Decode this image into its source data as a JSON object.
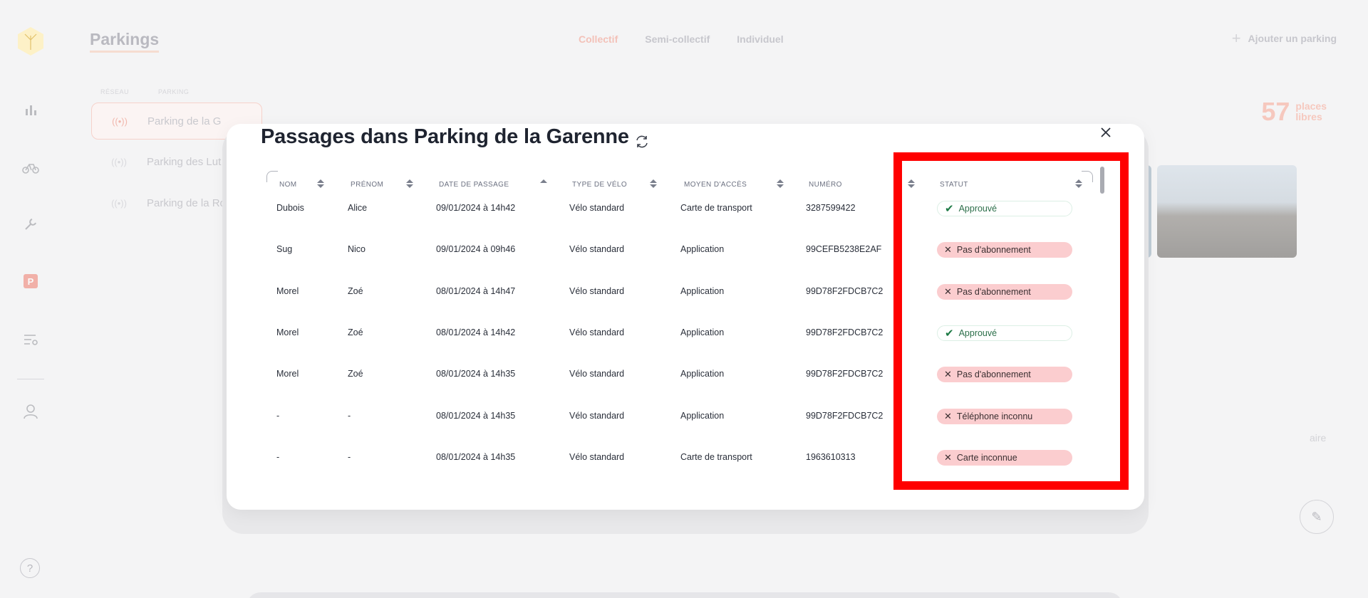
{
  "app": {
    "page_title": "Parkings",
    "tabs": [
      {
        "label": "Collectif",
        "active": true
      },
      {
        "label": "Semi-collectif",
        "active": false
      },
      {
        "label": "Individuel",
        "active": false
      }
    ],
    "add_button": "Ajouter un parking",
    "bg_table_headers": [
      "RÉSEAU",
      "PARKING"
    ],
    "bg_parkings": [
      {
        "label": "Parking de la G",
        "selected": true
      },
      {
        "label": "Parking des Lut",
        "selected": false
      },
      {
        "label": "Parking de la Ro",
        "selected": false
      }
    ],
    "places_count": "57",
    "places_label_1": "places",
    "places_label_2": "libres",
    "faded_text": "aire"
  },
  "modal": {
    "title": "Passages dans Parking de la Garenne",
    "columns": [
      {
        "key": "nom",
        "label": "NOM"
      },
      {
        "key": "prenom",
        "label": "PRÉNOM"
      },
      {
        "key": "date",
        "label": "DATE DE PASSAGE"
      },
      {
        "key": "type",
        "label": "TYPE DE VÉLO"
      },
      {
        "key": "acces",
        "label": "MOYEN D'ACCÈS"
      },
      {
        "key": "numero",
        "label": "NUMÉRO"
      },
      {
        "key": "statut",
        "label": "STATUT"
      }
    ],
    "rows": [
      {
        "nom": "Dubois",
        "prenom": "Alice",
        "date": "09/01/2024 à 14h42",
        "type": "Vélo standard",
        "acces": "Carte de transport",
        "numero": "3287599422",
        "statut": "Approuvé",
        "status_kind": "ok"
      },
      {
        "nom": "Sug",
        "prenom": "Nico",
        "date": "09/01/2024 à 09h46",
        "type": "Vélo standard",
        "acces": "Application",
        "numero": "99CEFB5238E2AF",
        "statut": "Pas d'abonnement",
        "status_kind": "err"
      },
      {
        "nom": "Morel",
        "prenom": "Zoé",
        "date": "08/01/2024 à 14h47",
        "type": "Vélo standard",
        "acces": "Application",
        "numero": "99D78F2FDCB7C2",
        "statut": "Pas d'abonnement",
        "status_kind": "err"
      },
      {
        "nom": "Morel",
        "prenom": "Zoé",
        "date": "08/01/2024 à 14h42",
        "type": "Vélo standard",
        "acces": "Application",
        "numero": "99D78F2FDCB7C2",
        "statut": "Approuvé",
        "status_kind": "ok"
      },
      {
        "nom": "Morel",
        "prenom": "Zoé",
        "date": "08/01/2024 à 14h35",
        "type": "Vélo standard",
        "acces": "Application",
        "numero": "99D78F2FDCB7C2",
        "statut": "Pas d'abonnement",
        "status_kind": "err"
      },
      {
        "nom": "-",
        "prenom": "-",
        "date": "08/01/2024 à 14h35",
        "type": "Vélo standard",
        "acces": "Application",
        "numero": "99D78F2FDCB7C2",
        "statut": "Téléphone inconnu",
        "status_kind": "err"
      },
      {
        "nom": "-",
        "prenom": "-",
        "date": "08/01/2024 à 14h35",
        "type": "Vélo standard",
        "acces": "Carte de transport",
        "numero": "1963610313",
        "statut": "Carte inconnue",
        "status_kind": "err"
      }
    ]
  },
  "colors": {
    "accent": "#f3c1b8",
    "approved_text": "#2c6f4a",
    "error_badge_bg": "#fbcdcf",
    "highlight_box": "#ff0000"
  },
  "icons": {
    "sidebar": [
      "chart-icon",
      "bike-icon",
      "wrench-icon",
      "parking-icon",
      "settings-list-icon",
      "user-icon",
      "help-icon"
    ],
    "modal": [
      "refresh-icon",
      "close-icon",
      "check-icon",
      "cross-icon"
    ]
  }
}
